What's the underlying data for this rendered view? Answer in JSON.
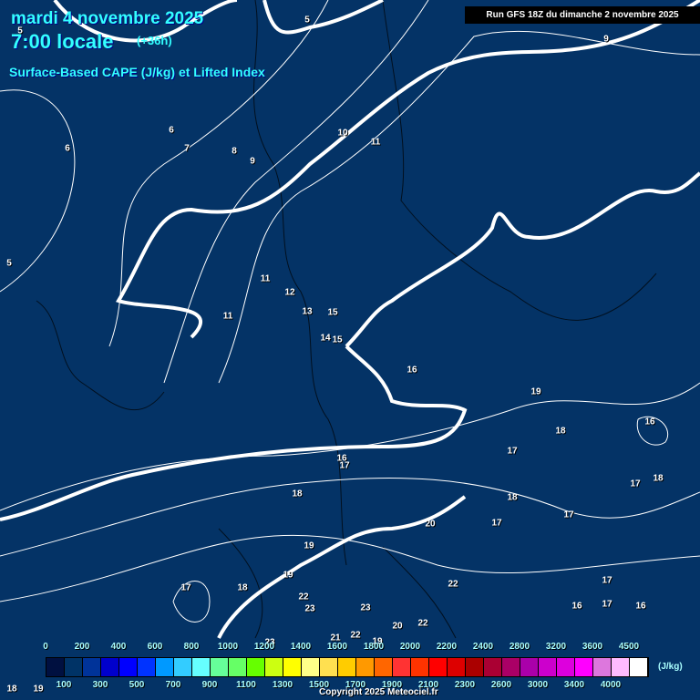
{
  "header": {
    "date": "mardi 4 novembre 2025",
    "time": "7:00 locale",
    "lead": "(+36h)",
    "parameter": "Surface-Based CAPE (J/kg) et Lifted Index",
    "run": "Run GFS 18Z du dimanche 2 novembre 2025"
  },
  "contour_labels": [
    "5",
    "5",
    "9",
    "6",
    "6",
    "7",
    "8",
    "9",
    "10",
    "11",
    "5",
    "11",
    "12",
    "11",
    "13",
    "15",
    "14",
    "15",
    "16",
    "19",
    "16",
    "18",
    "17",
    "17",
    "18",
    "16",
    "17",
    "18",
    "18",
    "20",
    "17",
    "17",
    "19",
    "19",
    "17",
    "18",
    "22",
    "22",
    "23",
    "23",
    "17",
    "16",
    "17",
    "16",
    "21",
    "22",
    "19",
    "20",
    "22",
    "23",
    "18",
    "19"
  ],
  "legend": {
    "unit": "(J/kg)",
    "top_labels": [
      "0",
      "200",
      "400",
      "600",
      "800",
      "1000",
      "1200",
      "1400",
      "1600",
      "1800",
      "2000",
      "2200",
      "2400",
      "2800",
      "3200",
      "3600",
      "4500"
    ],
    "bottom_labels": [
      "100",
      "300",
      "500",
      "700",
      "900",
      "1100",
      "1300",
      "1500",
      "1700",
      "1900",
      "2100",
      "2300",
      "2600",
      "3000",
      "3400",
      "4000"
    ],
    "colors": [
      "#001040",
      "#003366",
      "#003399",
      "#0000cc",
      "#0000ff",
      "#0033ff",
      "#0099ff",
      "#33ccff",
      "#66ffff",
      "#66ff99",
      "#66ff66",
      "#66ff00",
      "#ccff11",
      "#ffff00",
      "#ffff88",
      "#ffe050",
      "#ffcc00",
      "#ff9900",
      "#ff6600",
      "#ff3333",
      "#ff3300",
      "#ff0000",
      "#dd0000",
      "#aa0000",
      "#aa0033",
      "#aa0066",
      "#aa00aa",
      "#cc00cc",
      "#dd00dd",
      "#ff00ff",
      "#dd77dd",
      "#ffbbff",
      "#ffffff"
    ]
  },
  "copyright": "Copyright 2025 Meteociel.fr",
  "colors": {
    "background": "#043366",
    "title": "#33ffff",
    "contour": "#ffffff"
  }
}
